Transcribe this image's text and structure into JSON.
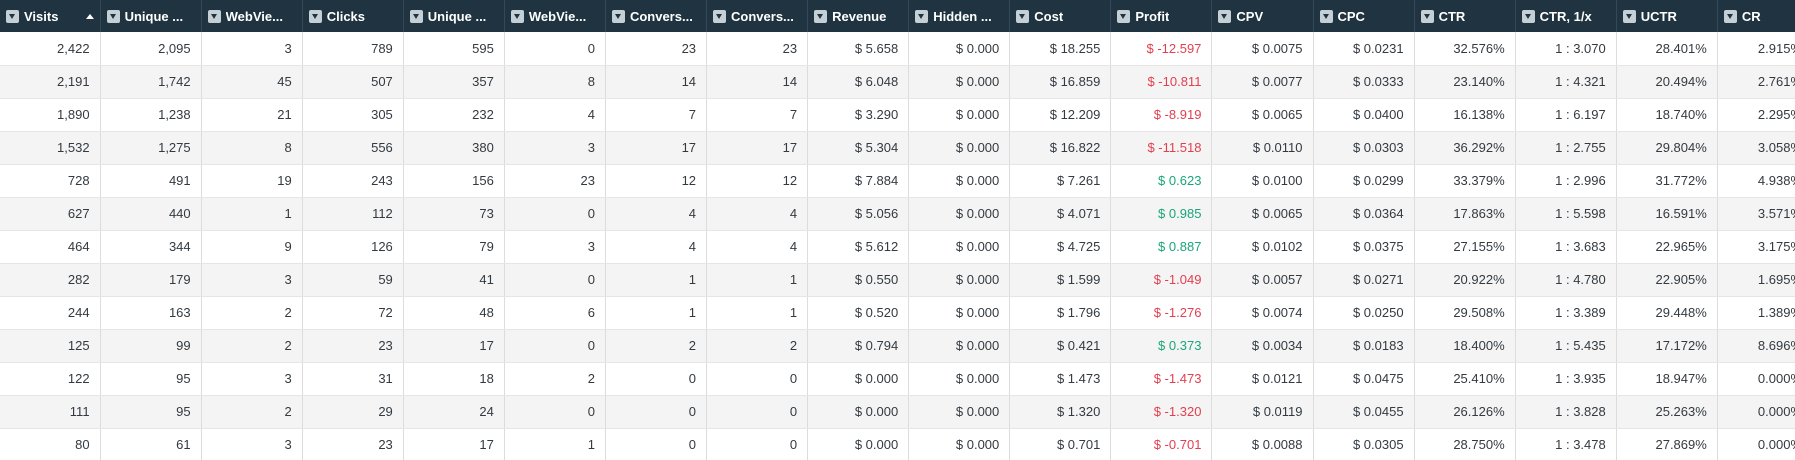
{
  "columns": [
    "Visits",
    "Unique ...",
    "WebVie...",
    "Clicks",
    "Unique ...",
    "WebVie...",
    "Convers...",
    "Convers...",
    "Revenue",
    "Hidden ...",
    "Cost",
    "Profit",
    "CPV",
    "CPC",
    "CTR",
    "CTR, 1/x",
    "UCTR",
    "CR"
  ],
  "icons": {
    "filter": "filter-dropdown-icon",
    "sort": "sort-ascending-icon"
  },
  "colors": {
    "header_bg": "#1f3440",
    "negative": "#e23f4f",
    "positive": "#1aa57a"
  },
  "rows": [
    {
      "cells": [
        "2,422",
        "2,095",
        "3",
        "789",
        "595",
        "0",
        "23",
        "23",
        "$ 5.658",
        "$ 0.000",
        "$ 18.255",
        "$ -12.597",
        "$ 0.0075",
        "$ 0.0231",
        "32.576%",
        "1 : 3.070",
        "28.401%",
        "2.915%"
      ],
      "profit": "neg"
    },
    {
      "cells": [
        "2,191",
        "1,742",
        "45",
        "507",
        "357",
        "8",
        "14",
        "14",
        "$ 6.048",
        "$ 0.000",
        "$ 16.859",
        "$ -10.811",
        "$ 0.0077",
        "$ 0.0333",
        "23.140%",
        "1 : 4.321",
        "20.494%",
        "2.761%"
      ],
      "profit": "neg"
    },
    {
      "cells": [
        "1,890",
        "1,238",
        "21",
        "305",
        "232",
        "4",
        "7",
        "7",
        "$ 3.290",
        "$ 0.000",
        "$ 12.209",
        "$ -8.919",
        "$ 0.0065",
        "$ 0.0400",
        "16.138%",
        "1 : 6.197",
        "18.740%",
        "2.295%"
      ],
      "profit": "neg"
    },
    {
      "cells": [
        "1,532",
        "1,275",
        "8",
        "556",
        "380",
        "3",
        "17",
        "17",
        "$ 5.304",
        "$ 0.000",
        "$ 16.822",
        "$ -11.518",
        "$ 0.0110",
        "$ 0.0303",
        "36.292%",
        "1 : 2.755",
        "29.804%",
        "3.058%"
      ],
      "profit": "neg"
    },
    {
      "cells": [
        "728",
        "491",
        "19",
        "243",
        "156",
        "23",
        "12",
        "12",
        "$ 7.884",
        "$ 0.000",
        "$ 7.261",
        "$ 0.623",
        "$ 0.0100",
        "$ 0.0299",
        "33.379%",
        "1 : 2.996",
        "31.772%",
        "4.938%"
      ],
      "profit": "pos"
    },
    {
      "cells": [
        "627",
        "440",
        "1",
        "112",
        "73",
        "0",
        "4",
        "4",
        "$ 5.056",
        "$ 0.000",
        "$ 4.071",
        "$ 0.985",
        "$ 0.0065",
        "$ 0.0364",
        "17.863%",
        "1 : 5.598",
        "16.591%",
        "3.571%"
      ],
      "profit": "pos"
    },
    {
      "cells": [
        "464",
        "344",
        "9",
        "126",
        "79",
        "3",
        "4",
        "4",
        "$ 5.612",
        "$ 0.000",
        "$ 4.725",
        "$ 0.887",
        "$ 0.0102",
        "$ 0.0375",
        "27.155%",
        "1 : 3.683",
        "22.965%",
        "3.175%"
      ],
      "profit": "pos"
    },
    {
      "cells": [
        "282",
        "179",
        "3",
        "59",
        "41",
        "0",
        "1",
        "1",
        "$ 0.550",
        "$ 0.000",
        "$ 1.599",
        "$ -1.049",
        "$ 0.0057",
        "$ 0.0271",
        "20.922%",
        "1 : 4.780",
        "22.905%",
        "1.695%"
      ],
      "profit": "neg"
    },
    {
      "cells": [
        "244",
        "163",
        "2",
        "72",
        "48",
        "6",
        "1",
        "1",
        "$ 0.520",
        "$ 0.000",
        "$ 1.796",
        "$ -1.276",
        "$ 0.0074",
        "$ 0.0250",
        "29.508%",
        "1 : 3.389",
        "29.448%",
        "1.389%"
      ],
      "profit": "neg"
    },
    {
      "cells": [
        "125",
        "99",
        "2",
        "23",
        "17",
        "0",
        "2",
        "2",
        "$ 0.794",
        "$ 0.000",
        "$ 0.421",
        "$ 0.373",
        "$ 0.0034",
        "$ 0.0183",
        "18.400%",
        "1 : 5.435",
        "17.172%",
        "8.696%"
      ],
      "profit": "pos"
    },
    {
      "cells": [
        "122",
        "95",
        "3",
        "31",
        "18",
        "2",
        "0",
        "0",
        "$ 0.000",
        "$ 0.000",
        "$ 1.473",
        "$ -1.473",
        "$ 0.0121",
        "$ 0.0475",
        "25.410%",
        "1 : 3.935",
        "18.947%",
        "0.000%"
      ],
      "profit": "neg"
    },
    {
      "cells": [
        "111",
        "95",
        "2",
        "29",
        "24",
        "0",
        "0",
        "0",
        "$ 0.000",
        "$ 0.000",
        "$ 1.320",
        "$ -1.320",
        "$ 0.0119",
        "$ 0.0455",
        "26.126%",
        "1 : 3.828",
        "25.263%",
        "0.000%"
      ],
      "profit": "neg"
    },
    {
      "cells": [
        "80",
        "61",
        "3",
        "23",
        "17",
        "1",
        "0",
        "0",
        "$ 0.000",
        "$ 0.000",
        "$ 0.701",
        "$ -0.701",
        "$ 0.0088",
        "$ 0.0305",
        "28.750%",
        "1 : 3.478",
        "27.869%",
        "0.000%"
      ],
      "profit": "neg"
    }
  ]
}
